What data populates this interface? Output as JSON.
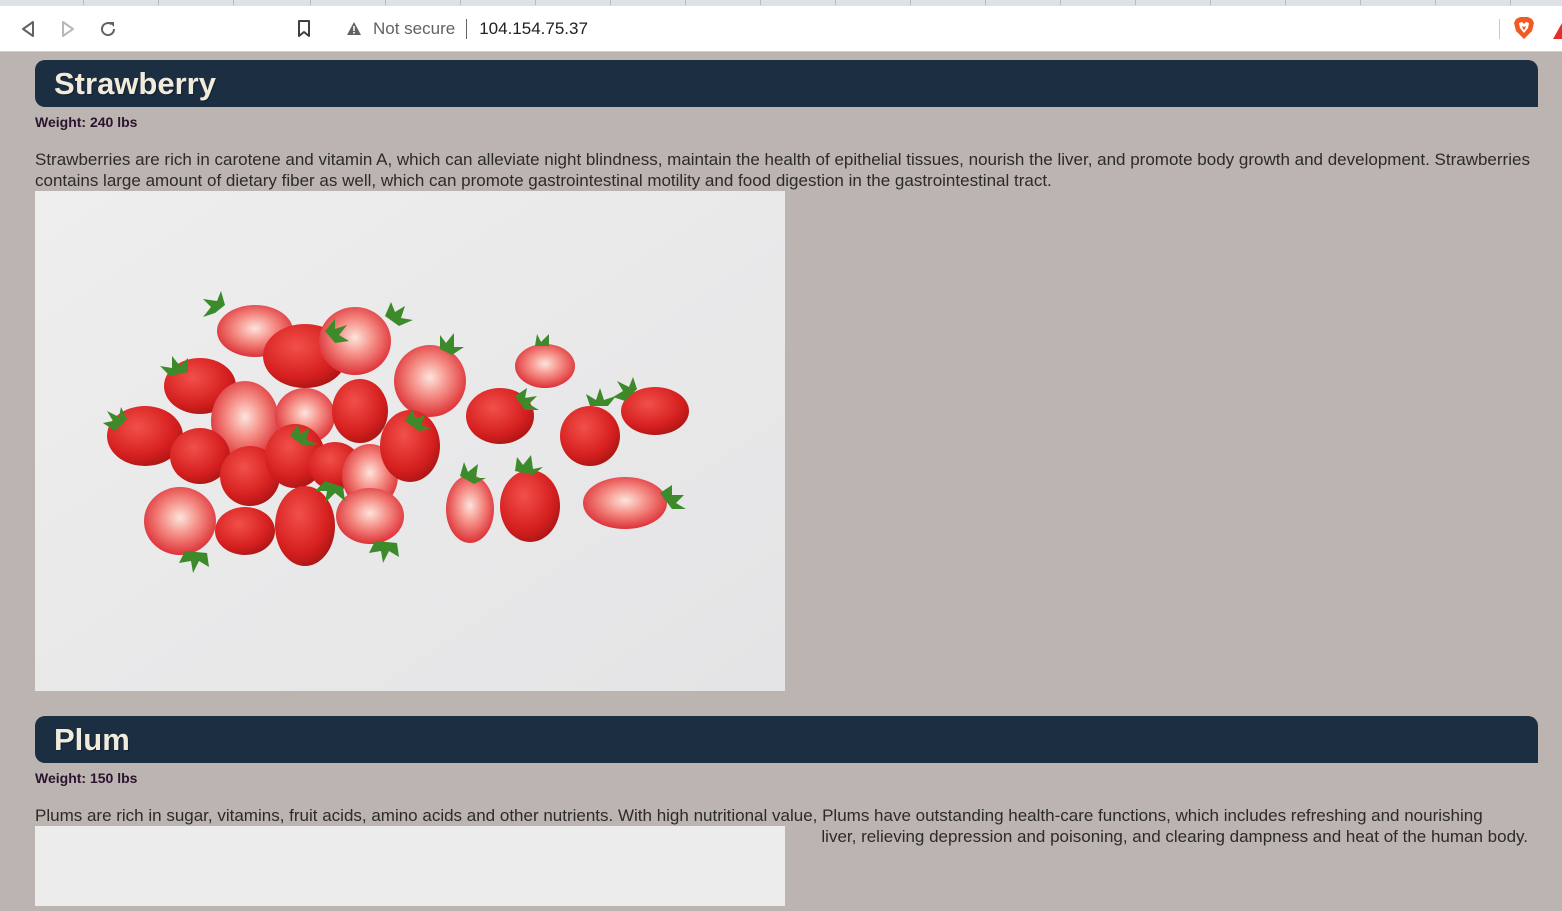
{
  "browser": {
    "address": {
      "security_label": "Not secure",
      "url": "104.154.75.37"
    },
    "icons": {
      "back": "back-arrow-icon",
      "forward": "forward-arrow-icon",
      "reload": "reload-icon",
      "bookmark": "bookmark-icon",
      "warning": "warning-triangle-icon",
      "brave": "brave-shield-icon",
      "rewards": "brave-rewards-icon"
    }
  },
  "colors": {
    "page_background": "#bcb4b0",
    "header_background": "#1c2e42",
    "header_text": "#f2ebdc",
    "weight_text": "#2b1230",
    "body_text": "#2b2b2b"
  },
  "fruits": [
    {
      "name": "Strawberry",
      "weight": "Weight: 240 lbs",
      "description": "Strawberries are rich in carotene and vitamin A, which can alleviate night blindness, maintain the health of epithelial tissues, nourish the liver, and promote body growth and development. Strawberries contains large amount of dietary fiber as well, which can promote gastrointestinal motility and food digestion in the gastrointestinal tract."
    },
    {
      "name": "Plum",
      "weight": "Weight: 150 lbs",
      "description_line1": "Plums are rich in sugar, vitamins, fruit acids, amino acids and other nutrients. With high nutritional value, Plums have outstanding health-care functions, which includes refreshing and nourishing",
      "description_line2": "liver, relieving depression and poisoning, and clearing dampness and heat of the human body."
    }
  ]
}
